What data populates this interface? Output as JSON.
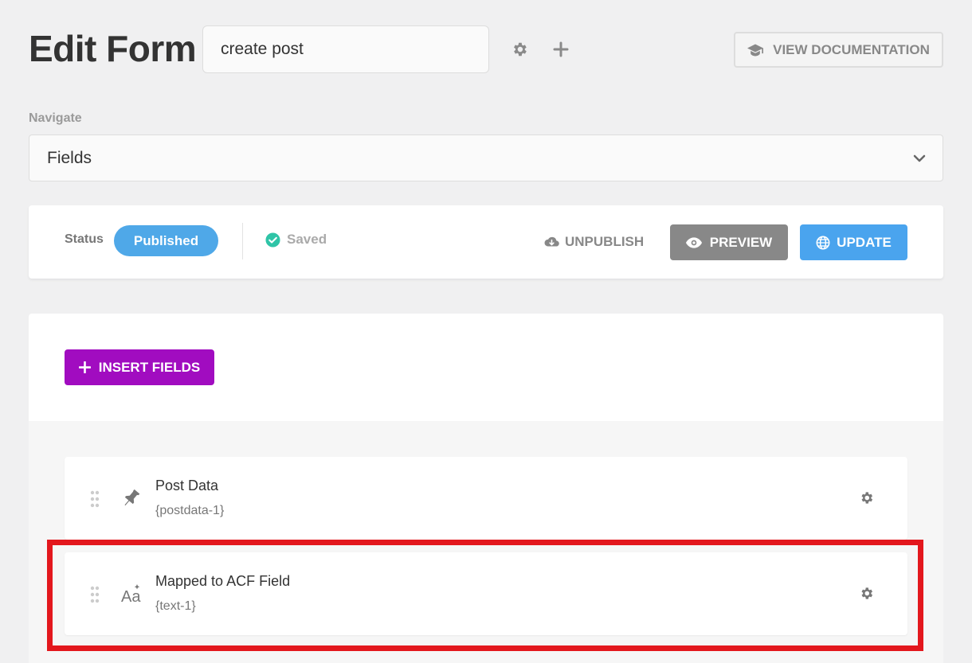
{
  "header": {
    "title": "Edit Form",
    "form_name": "create post",
    "settings_icon": "gear-icon",
    "add_icon": "plus-icon",
    "docs_label": "VIEW DOCUMENTATION",
    "docs_icon": "graduation-cap-icon"
  },
  "navigate": {
    "label": "Navigate",
    "selected": "Fields"
  },
  "status_bar": {
    "status_label": "Status",
    "status_value": "Published",
    "saved_label": "Saved",
    "unpublish_label": "UNPUBLISH",
    "preview_label": "PREVIEW",
    "update_label": "UPDATE"
  },
  "builder": {
    "insert_label": "INSERT FIELDS",
    "fields": [
      {
        "name": "Post Data",
        "tag": "{postdata-1}",
        "icon": "pin-icon"
      },
      {
        "name": "Mapped to ACF Field",
        "tag": "{text-1}",
        "icon": "text-style-icon"
      }
    ]
  },
  "colors": {
    "accent_blue": "#4aa4ee",
    "insert_purple": "#a10cc0",
    "saved_green": "#2fc4a7",
    "highlight_red": "#e3171d"
  }
}
